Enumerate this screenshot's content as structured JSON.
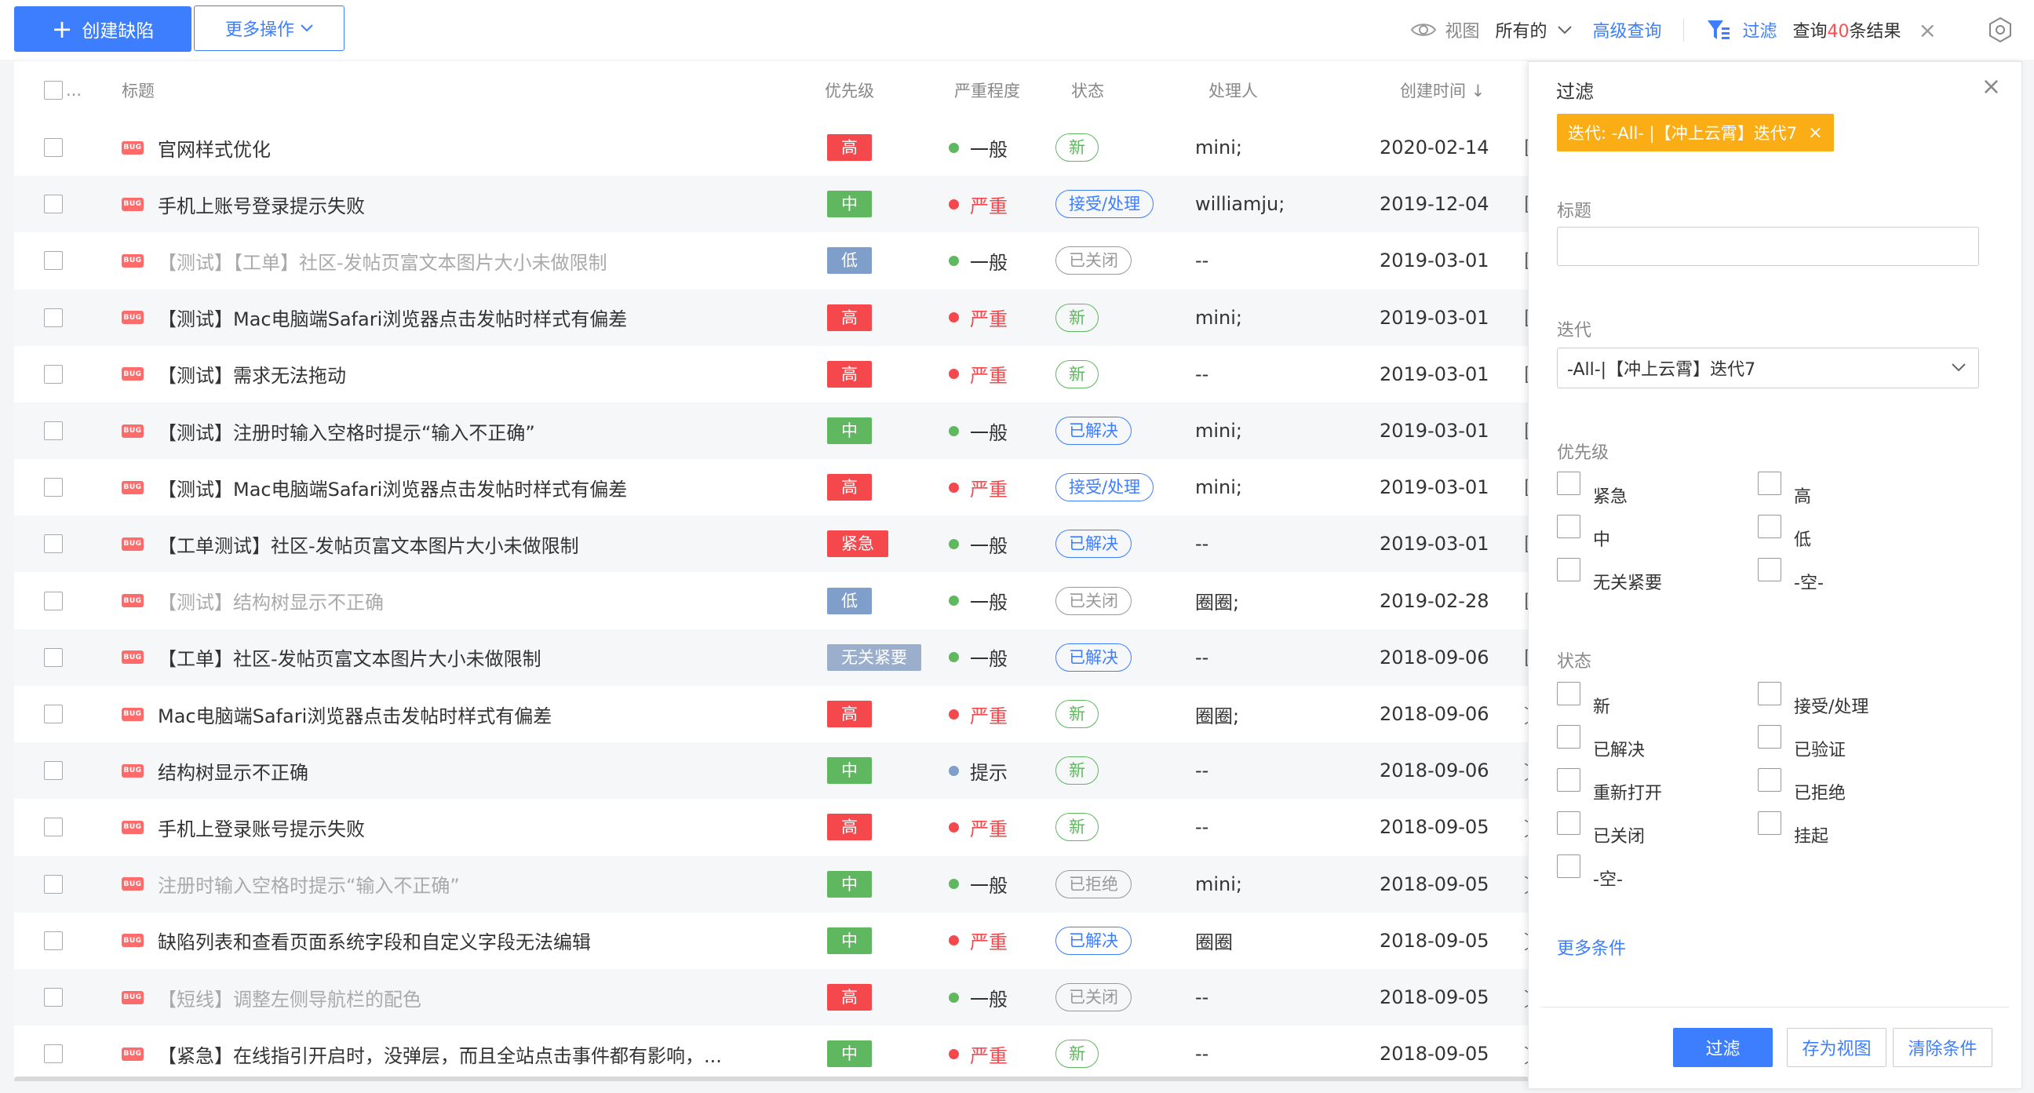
{
  "colors": {
    "primary": "#3d7eff",
    "prio_high": "#f5484d",
    "prio_mid": "#5fb85f",
    "prio_low": "#7f9ec9",
    "prio_urgent": "#f5484d",
    "prio_none": "#9baecb",
    "sev_normal": "#5fb85f",
    "sev_severe": "#f5484d",
    "sev_hint": "#7f9ec9",
    "status_new": "#5fb85f",
    "status_blue": "#3d7eff",
    "status_closed": "#999999",
    "chip": "#faad14"
  },
  "toolbar": {
    "create_label": "创建缺陷",
    "more_label": "更多操作",
    "view_label": "视图",
    "view_value": "所有的",
    "advanced_query": "高级查询",
    "filter_label": "过滤",
    "result_prefix": "查询",
    "result_count": "40",
    "result_suffix": "条结果",
    "icons": [
      "plus-icon",
      "chevron-down-icon",
      "eye-icon",
      "filter-icon",
      "close-icon",
      "gear-icon"
    ]
  },
  "table": {
    "headers": {
      "select_all": "...",
      "title": "标题",
      "priority": "优先级",
      "severity": "严重程度",
      "status": "状态",
      "owner": "处理人",
      "created": "创建时间 ↓"
    },
    "bug_tag": "BUG",
    "rows": [
      {
        "title": "官网样式优化",
        "priority": "高",
        "prio_color": "#f5484d",
        "severity": "一般",
        "sev_color": "#5fb85f",
        "sev_text_color": "#333333",
        "status": "新",
        "status_color": "#5fb85f",
        "owner": "mini;",
        "date": "2020-02-14",
        "closed": false
      },
      {
        "title": "手机上账号登录提示失败",
        "priority": "中",
        "prio_color": "#5fb85f",
        "severity": "严重",
        "sev_color": "#f5484d",
        "sev_text_color": "#f5484d",
        "status": "接受/处理",
        "status_color": "#3d7eff",
        "owner": "williamju;",
        "date": "2019-12-04",
        "closed": false
      },
      {
        "title": "【测试】【工单】社区-发帖页富文本图片大小未做限制",
        "priority": "低",
        "prio_color": "#7f9ec9",
        "severity": "一般",
        "sev_color": "#5fb85f",
        "sev_text_color": "#333333",
        "status": "已关闭",
        "status_color": "#999999",
        "owner": "--",
        "date": "2019-03-01",
        "closed": true
      },
      {
        "title": "【测试】Mac电脑端Safari浏览器点击发帖时样式有偏差",
        "priority": "高",
        "prio_color": "#f5484d",
        "severity": "严重",
        "sev_color": "#f5484d",
        "sev_text_color": "#f5484d",
        "status": "新",
        "status_color": "#5fb85f",
        "owner": "mini;",
        "date": "2019-03-01",
        "closed": false
      },
      {
        "title": "【测试】需求无法拖动",
        "priority": "高",
        "prio_color": "#f5484d",
        "severity": "严重",
        "sev_color": "#f5484d",
        "sev_text_color": "#f5484d",
        "status": "新",
        "status_color": "#5fb85f",
        "owner": "--",
        "date": "2019-03-01",
        "closed": false
      },
      {
        "title": "【测试】注册时输入空格时提示“输入不正确”",
        "priority": "中",
        "prio_color": "#5fb85f",
        "severity": "一般",
        "sev_color": "#5fb85f",
        "sev_text_color": "#333333",
        "status": "已解决",
        "status_color": "#3d7eff",
        "owner": "mini;",
        "date": "2019-03-01",
        "closed": false
      },
      {
        "title": "【测试】Mac电脑端Safari浏览器点击发帖时样式有偏差",
        "priority": "高",
        "prio_color": "#f5484d",
        "severity": "严重",
        "sev_color": "#f5484d",
        "sev_text_color": "#f5484d",
        "status": "接受/处理",
        "status_color": "#3d7eff",
        "owner": "mini;",
        "date": "2019-03-01",
        "closed": false
      },
      {
        "title": "【工单测试】社区-发帖页富文本图片大小未做限制",
        "priority": "紧急",
        "prio_color": "#f5484d",
        "severity": "一般",
        "sev_color": "#5fb85f",
        "sev_text_color": "#333333",
        "status": "已解决",
        "status_color": "#3d7eff",
        "owner": "--",
        "date": "2019-03-01",
        "closed": false
      },
      {
        "title": "【测试】结构树显示不正确",
        "priority": "低",
        "prio_color": "#7f9ec9",
        "severity": "一般",
        "sev_color": "#5fb85f",
        "sev_text_color": "#333333",
        "status": "已关闭",
        "status_color": "#999999",
        "owner": "圈圈;",
        "date": "2019-02-28",
        "closed": true
      },
      {
        "title": "【工单】社区-发帖页富文本图片大小未做限制",
        "priority": "无关紧要",
        "prio_color": "#9baecb",
        "severity": "一般",
        "sev_color": "#5fb85f",
        "sev_text_color": "#333333",
        "status": "已解决",
        "status_color": "#3d7eff",
        "owner": "--",
        "date": "2018-09-06",
        "closed": false
      },
      {
        "title": "Mac电脑端Safari浏览器点击发帖时样式有偏差",
        "priority": "高",
        "prio_color": "#f5484d",
        "severity": "严重",
        "sev_color": "#f5484d",
        "sev_text_color": "#f5484d",
        "status": "新",
        "status_color": "#5fb85f",
        "owner": "圈圈;",
        "date": "2018-09-06",
        "closed": false
      },
      {
        "title": "结构树显示不正确",
        "priority": "中",
        "prio_color": "#5fb85f",
        "severity": "提示",
        "sev_color": "#7f9ec9",
        "sev_text_color": "#333333",
        "status": "新",
        "status_color": "#5fb85f",
        "owner": "--",
        "date": "2018-09-06",
        "closed": false
      },
      {
        "title": "手机上登录账号提示失败",
        "priority": "高",
        "prio_color": "#f5484d",
        "severity": "严重",
        "sev_color": "#f5484d",
        "sev_text_color": "#f5484d",
        "status": "新",
        "status_color": "#5fb85f",
        "owner": "--",
        "date": "2018-09-05",
        "closed": false
      },
      {
        "title": "注册时输入空格时提示“输入不正确”",
        "priority": "中",
        "prio_color": "#5fb85f",
        "severity": "一般",
        "sev_color": "#5fb85f",
        "sev_text_color": "#333333",
        "status": "已拒绝",
        "status_color": "#999999",
        "owner": "mini;",
        "date": "2018-09-05",
        "closed": true
      },
      {
        "title": "缺陷列表和查看页面系统字段和自定义字段无法编辑",
        "priority": "中",
        "prio_color": "#5fb85f",
        "severity": "严重",
        "sev_color": "#f5484d",
        "sev_text_color": "#f5484d",
        "status": "已解决",
        "status_color": "#3d7eff",
        "owner": "圈圈",
        "date": "2018-09-05",
        "closed": false
      },
      {
        "title": "【短线】调整左侧导航栏的配色",
        "priority": "高",
        "prio_color": "#f5484d",
        "severity": "一般",
        "sev_color": "#5fb85f",
        "sev_text_color": "#333333",
        "status": "已关闭",
        "status_color": "#999999",
        "owner": "--",
        "date": "2018-09-05",
        "closed": true
      },
      {
        "title": "【紧急】在线指引开启时，没弹层，而且全站点击事件都有影响，...",
        "priority": "中",
        "prio_color": "#5fb85f",
        "severity": "严重",
        "sev_color": "#f5484d",
        "sev_text_color": "#f5484d",
        "status": "新",
        "status_color": "#5fb85f",
        "owner": "--",
        "date": "2018-09-05",
        "closed": false
      }
    ],
    "extra_column_glyphs": [
      "[",
      "[",
      "[",
      "[",
      "[",
      "[",
      "[",
      "[",
      "[",
      "[",
      "〕",
      "〕",
      "〕",
      "〕",
      "〕",
      "〕",
      "〕"
    ]
  },
  "filter_panel": {
    "title": "过滤",
    "chip_text": "迭代: -All- |【冲上云霄】迭代7",
    "title_label": "标题",
    "title_value": "",
    "iteration_label": "迭代",
    "iteration_value": "-All-|【冲上云霄】迭代7",
    "priority_label": "优先级",
    "priority_options": [
      "紧急",
      "高",
      "中",
      "低",
      "无关紧要",
      "-空-"
    ],
    "status_label": "状态",
    "status_options": [
      "新",
      "接受/处理",
      "已解决",
      "已验证",
      "重新打开",
      "已拒绝",
      "已关闭",
      "挂起",
      "-空-"
    ],
    "more_conditions": "更多条件",
    "btn_filter": "过滤",
    "btn_save_view": "存为视图",
    "btn_clear": "清除条件"
  }
}
